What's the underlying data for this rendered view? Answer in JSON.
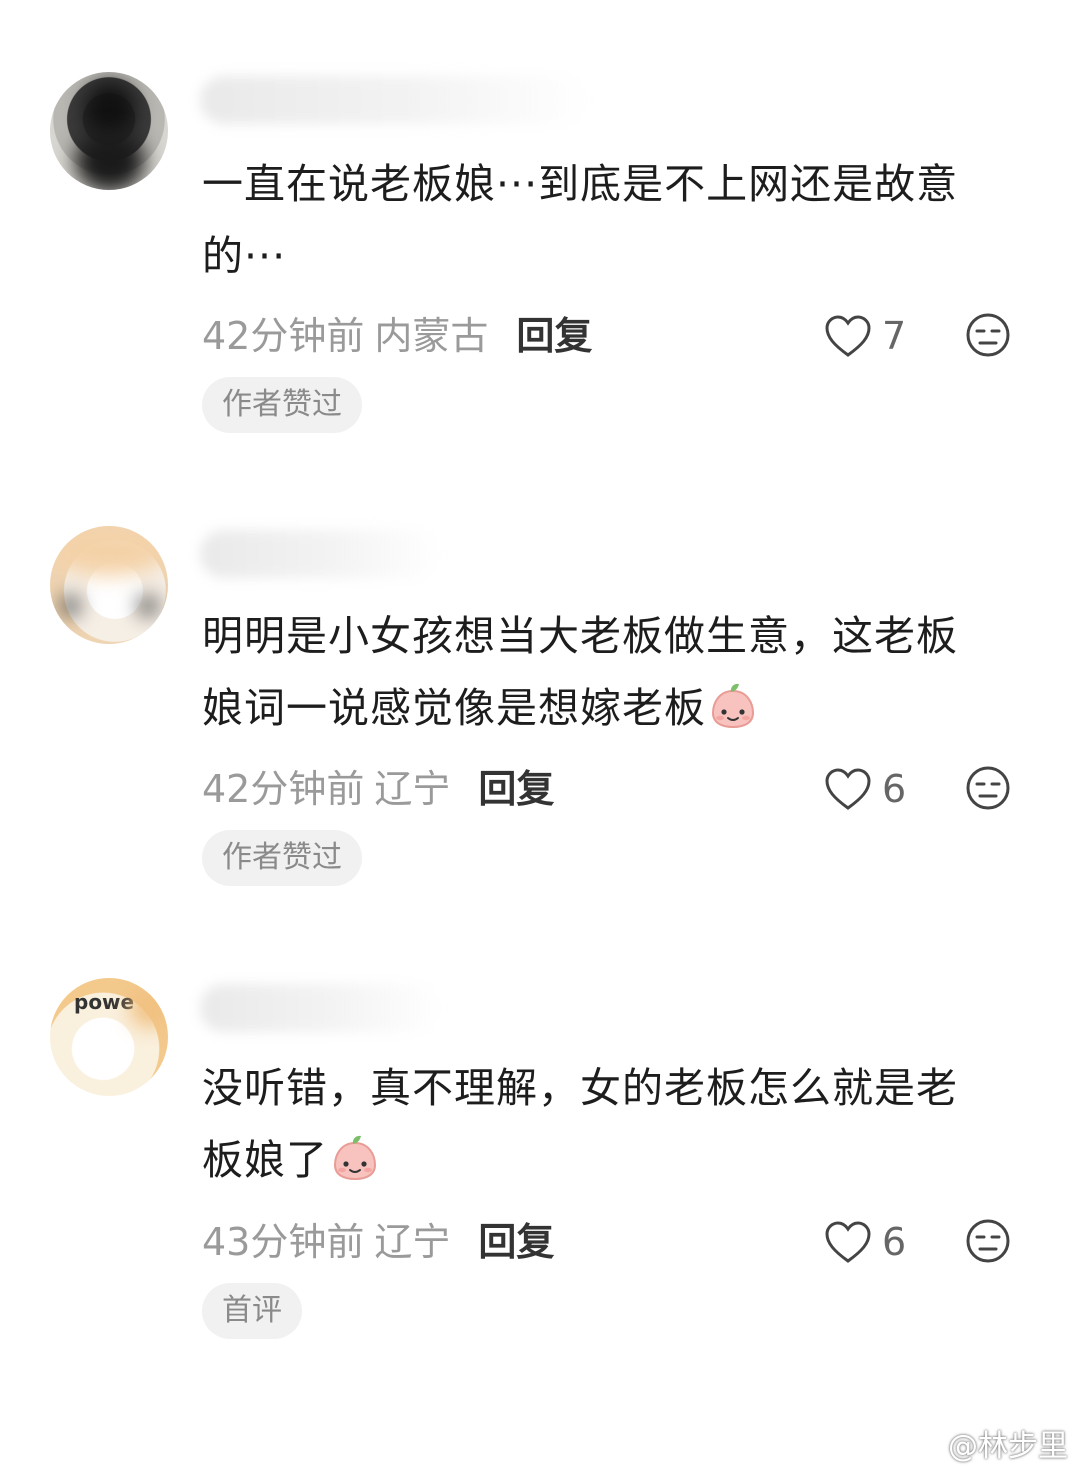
{
  "comments": [
    {
      "text_line1": "一直在说老板娘···到底是不上网还是故意",
      "text_line2": "的···",
      "time": "42分钟前",
      "location": "内蒙古",
      "reply_label": "回复",
      "likes": "7",
      "tag": "作者赞过"
    },
    {
      "text_line1": "明明是小女孩想当大老板做生意，这老板",
      "text_line2": "娘词一说感觉像是想嫁老板",
      "time": "42分钟前",
      "location": "辽宁",
      "reply_label": "回复",
      "likes": "6",
      "tag": "作者赞过"
    },
    {
      "text_line1": "没听错，真不理解，女的老板怎么就是老",
      "text_line2": "板娘了",
      "avatar_text": "powe",
      "time": "43分钟前",
      "location": "辽宁",
      "reply_label": "回复",
      "likes": "6",
      "tag": "首评"
    }
  ],
  "watermark": {
    "text": "@林步里"
  },
  "colors": {
    "meta_gray": "#9a9a9a",
    "tag_bg": "#f1f1f1",
    "emoji_pink": "#f6b5b0"
  }
}
